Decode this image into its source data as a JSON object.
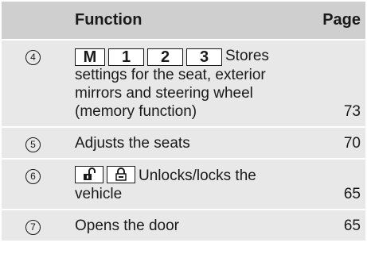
{
  "header": {
    "function": "Function",
    "page": "Page"
  },
  "rows": [
    {
      "num": "4",
      "keys": [
        "M",
        "1",
        "2",
        "3"
      ],
      "text": "Stores settings for the seat, exterior mirrors and steering wheel (memory function)",
      "page": "73"
    },
    {
      "num": "5",
      "text": "Adjusts the seats",
      "page": "70"
    },
    {
      "num": "6",
      "icons": [
        "unlock-icon",
        "lock-icon"
      ],
      "text": "Unlocks/locks the vehicle",
      "page": "65"
    },
    {
      "num": "7",
      "text": "Opens the door",
      "page": "65"
    }
  ]
}
